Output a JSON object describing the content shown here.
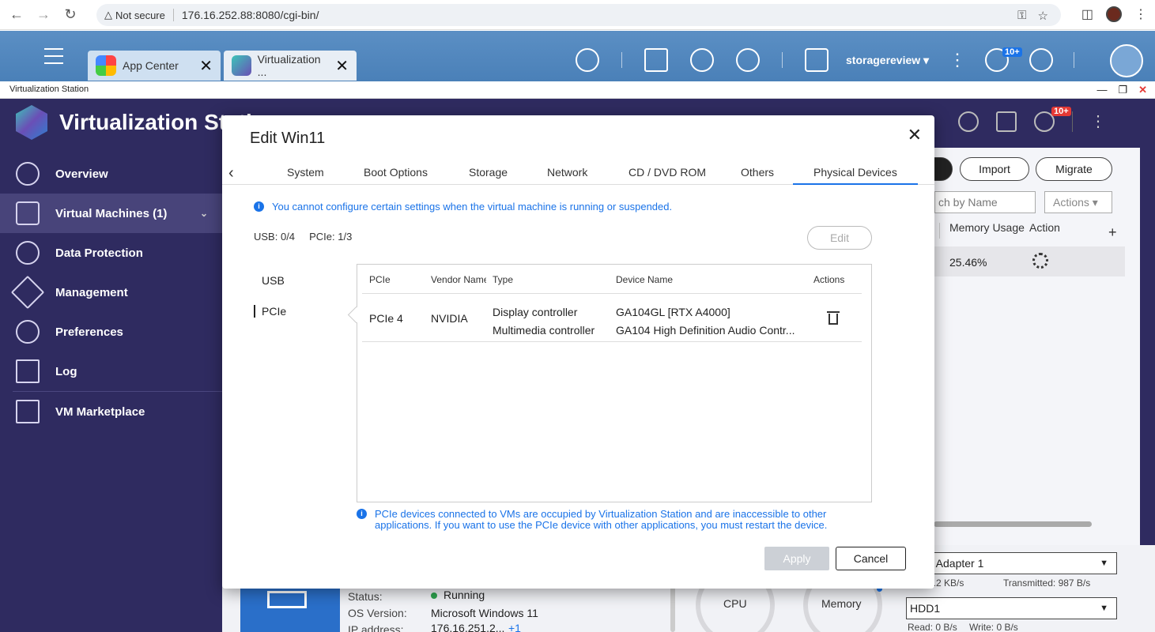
{
  "browser": {
    "security_label": "Not secure",
    "url": "176.16.252.88:8080/cgi-bin/"
  },
  "qts": {
    "tabs": [
      {
        "label": "App Center"
      },
      {
        "label": "Virtualization ..."
      }
    ],
    "username": "storagereview",
    "badge": "10+"
  },
  "window": {
    "title": "Virtualization Station"
  },
  "app": {
    "title": "Virtualization Station",
    "badge": "10+",
    "sidebar": [
      {
        "label": "Overview",
        "icon": "gauge-icon"
      },
      {
        "label": "Virtual Machines (1)",
        "icon": "cube-icon"
      },
      {
        "label": "Data Protection",
        "icon": "shield-icon"
      },
      {
        "label": "Management",
        "icon": "wrench-icon"
      },
      {
        "label": "Preferences",
        "icon": "gear-icon"
      },
      {
        "label": "Log",
        "icon": "log-icon"
      },
      {
        "label": "VM Marketplace",
        "icon": "store-icon"
      }
    ],
    "toolbar": {
      "import": "Import",
      "migrate": "Migrate"
    },
    "search_placeholder": "ch by Name",
    "actions_label": "Actions",
    "columns": {
      "memory": "Memory Usage",
      "action": "Action",
      "add": "+"
    },
    "row": {
      "memory": "25.46%"
    },
    "network": {
      "adapter": "work Adapter 1",
      "received": "ved: 1.2 KB/s",
      "transmitted": "Transmitted: 987 B/s"
    },
    "disk": {
      "name": "HDD1",
      "read": "Read: 0 B/s",
      "write": "Write: 0 B/s"
    },
    "gauges": {
      "cpu": "CPU",
      "memory": "Memory"
    },
    "vm_info": {
      "status_label": "Status:",
      "status_value": "Running",
      "os_label": "OS Version:",
      "os_value": "Microsoft Windows 11",
      "ip_label": "IP address:",
      "ip_value": "176.16.251.2...",
      "ip_more": "+1"
    }
  },
  "modal": {
    "title": "Edit Win11",
    "tabs": [
      "System",
      "Boot Options",
      "Storage",
      "Network",
      "CD / DVD ROM",
      "Others",
      "Physical Devices"
    ],
    "notice": "You cannot configure certain settings when the virtual machine is running or suspended.",
    "usb_label": "USB:",
    "usb_value": "0/4",
    "pcie_label": "PCIe:",
    "pcie_value": "1/3",
    "edit_label": "Edit",
    "side_tabs": {
      "usb": "USB",
      "pcie": "PCIe"
    },
    "table": {
      "headers": [
        "PCIe",
        "Vendor Name",
        "Type",
        "Device Name",
        "Actions"
      ],
      "rows": [
        {
          "pcie": "PCIe 4",
          "vendor": "NVIDIA",
          "type1": "Display controller",
          "type2": "Multimedia controller",
          "device1": "GA104GL [RTX A4000]",
          "device2": "GA104 High Definition Audio Contr..."
        }
      ]
    },
    "footer_notice": "PCIe devices connected to VMs are occupied by Virtualization Station and are inaccessible to other applications. If you want to use the PCIe device with other applications, you must restart the device.",
    "apply_label": "Apply",
    "cancel_label": "Cancel"
  }
}
